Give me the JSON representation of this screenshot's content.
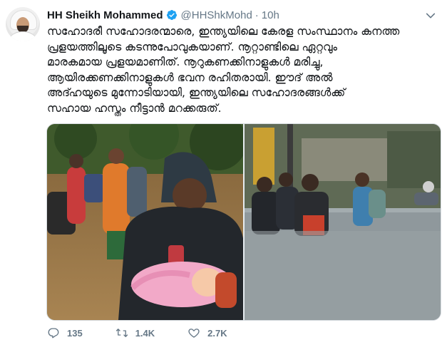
{
  "author": {
    "name": "HH Sheikh Mohammed",
    "handle": "@HHShkMohd",
    "time": "10h",
    "separator": "·"
  },
  "tweet": {
    "text": "സഹോദരീ സഹോദരന്മാരെ, ഇന്ത്യയിലെ കേരള സംസ്ഥാനം കനത്ത\nപ്രളയത്തിലൂടെ കടന്നുപോവുകയാണ്. നൂറ്റാണ്ടിലെ ഏറ്റവും\nമാരകമായ പ്രളയമാണിത്. നൂറുകണക്കിനാളുകൾ മരിച്ചു,\nആയിരക്കണക്കിനാളുകൾ ഭവന രഹിതരായി. ഈദ് അൽ\nഅദ്ഹയുടെ മുന്നോടിയായി, ഇന്ത്യയിലെ സഹോദരങ്ങൾക്ക്\nസഹായ ഹസ്തം നീട്ടാൻ മറക്കരുത്."
  },
  "actions": {
    "replies": "135",
    "retweets": "1.4K",
    "likes": "2.7K"
  },
  "icons": {
    "verified": "verified-badge-icon",
    "caret": "chevron-down-icon",
    "reply": "reply-icon",
    "retweet": "retweet-icon",
    "like": "heart-icon"
  },
  "colors": {
    "verified": "#1da1f2",
    "secondary_text": "#657786",
    "text": "#14171a"
  }
}
